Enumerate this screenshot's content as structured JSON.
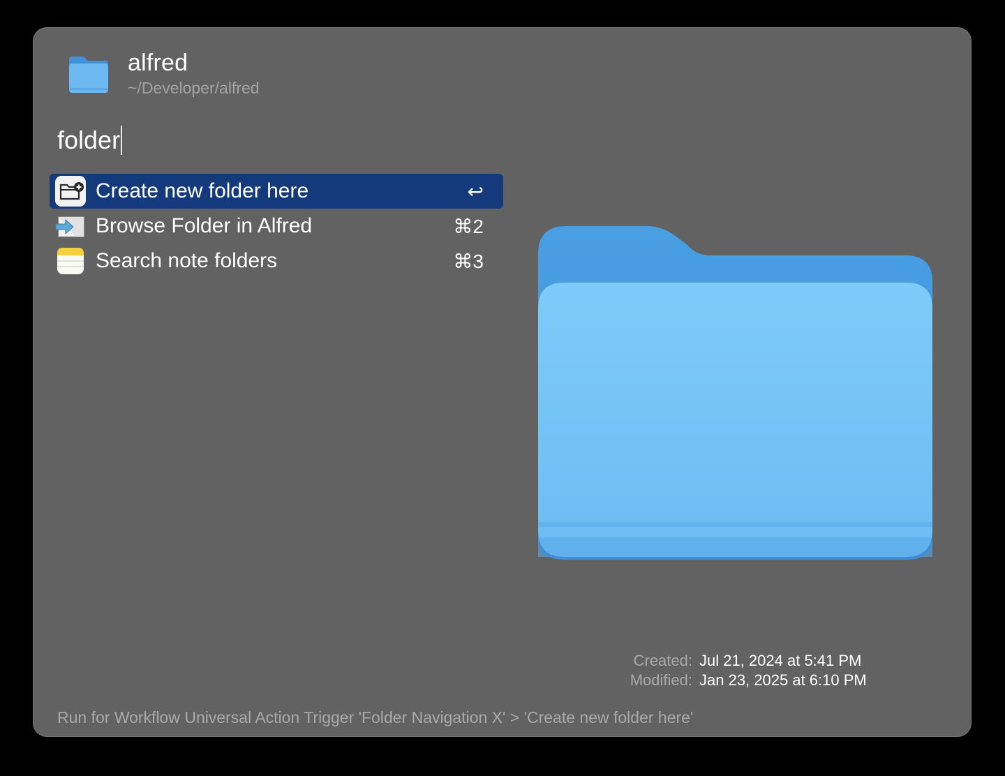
{
  "header": {
    "icon": "folder-icon",
    "title": "alfred",
    "path": "~/Developer/alfred"
  },
  "search": {
    "query": "folder"
  },
  "results": [
    {
      "icon": "new-folder-icon",
      "label": "Create new folder here",
      "shortcut": "↩",
      "selected": true
    },
    {
      "icon": "browse-folder-icon",
      "label": "Browse Folder in Alfred",
      "shortcut": "⌘2",
      "selected": false
    },
    {
      "icon": "notes-icon",
      "label": "Search note folders",
      "shortcut": "⌘3",
      "selected": false
    }
  ],
  "preview": {
    "icon": "large-folder-icon",
    "meta": [
      {
        "key": "Created:",
        "value": "Jul 21, 2024 at 5:41 PM"
      },
      {
        "key": "Modified:",
        "value": "Jan 23, 2025 at 6:10 PM"
      }
    ]
  },
  "footer": {
    "text": "Run for Workflow Universal Action Trigger 'Folder Navigation X' > 'Create new folder here'"
  },
  "colors": {
    "window_bg": "#626262",
    "selection": "#153a7b",
    "folder_light": "#78c4f7",
    "folder_dark": "#4ea3e6"
  }
}
